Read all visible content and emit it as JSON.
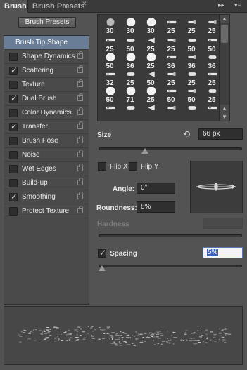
{
  "tabs": {
    "active": "Brush",
    "inactive": "Brush Presets"
  },
  "icons": {
    "close": "close-icon",
    "collapse": "double-chevron-icon",
    "menu": "panel-menu-icon",
    "reset": "reset-size-icon",
    "lock": "lock-icon"
  },
  "left": {
    "presets_button": "Brush Presets",
    "tip_shape": "Brush Tip Shape",
    "options": [
      {
        "label": "Shape Dynamics",
        "checked": false
      },
      {
        "label": "Scattering",
        "checked": true
      },
      {
        "label": "Texture",
        "checked": false
      },
      {
        "label": "Dual Brush",
        "checked": true
      },
      {
        "label": "Color Dynamics",
        "checked": false
      },
      {
        "label": "Transfer",
        "checked": true
      },
      {
        "label": "Brush Pose",
        "checked": false
      },
      {
        "label": "Noise",
        "checked": false
      },
      {
        "label": "Wet Edges",
        "checked": false
      },
      {
        "label": "Build-up",
        "checked": false
      },
      {
        "label": "Smoothing",
        "checked": true
      },
      {
        "label": "Protect Texture",
        "checked": false
      }
    ]
  },
  "brushes": [
    [
      "",
      "",
      "",
      "",
      "",
      ""
    ],
    [
      "30",
      "30",
      "30",
      "25",
      "25",
      "25"
    ],
    [
      "25",
      "50",
      "25",
      "25",
      "50",
      "50"
    ],
    [
      "50",
      "36",
      "25",
      "36",
      "36",
      "36"
    ],
    [
      "32",
      "25",
      "50",
      "25",
      "25",
      "25"
    ],
    [
      "50",
      "71",
      "25",
      "50",
      "50",
      "25"
    ]
  ],
  "brush_numbers": [
    [
      "30",
      "30",
      "30",
      "25",
      "25",
      "25"
    ],
    [
      "25",
      "50",
      "25",
      "25",
      "50",
      "50"
    ],
    [
      "50",
      "36",
      "25",
      "36",
      "36",
      "36"
    ],
    [
      "32",
      "25",
      "50",
      "25",
      "25",
      "25"
    ],
    [
      "50",
      "71",
      "25",
      "50",
      "50",
      "25"
    ]
  ],
  "size": {
    "label": "Size",
    "value": "66 px"
  },
  "flip_x": "Flip X",
  "flip_y": "Flip Y",
  "angle": {
    "label": "Angle:",
    "value": "0°"
  },
  "roundness": {
    "label": "Roundness:",
    "value": "8%"
  },
  "hardness": {
    "label": "Hardness"
  },
  "spacing": {
    "label": "Spacing",
    "value": "5%"
  }
}
